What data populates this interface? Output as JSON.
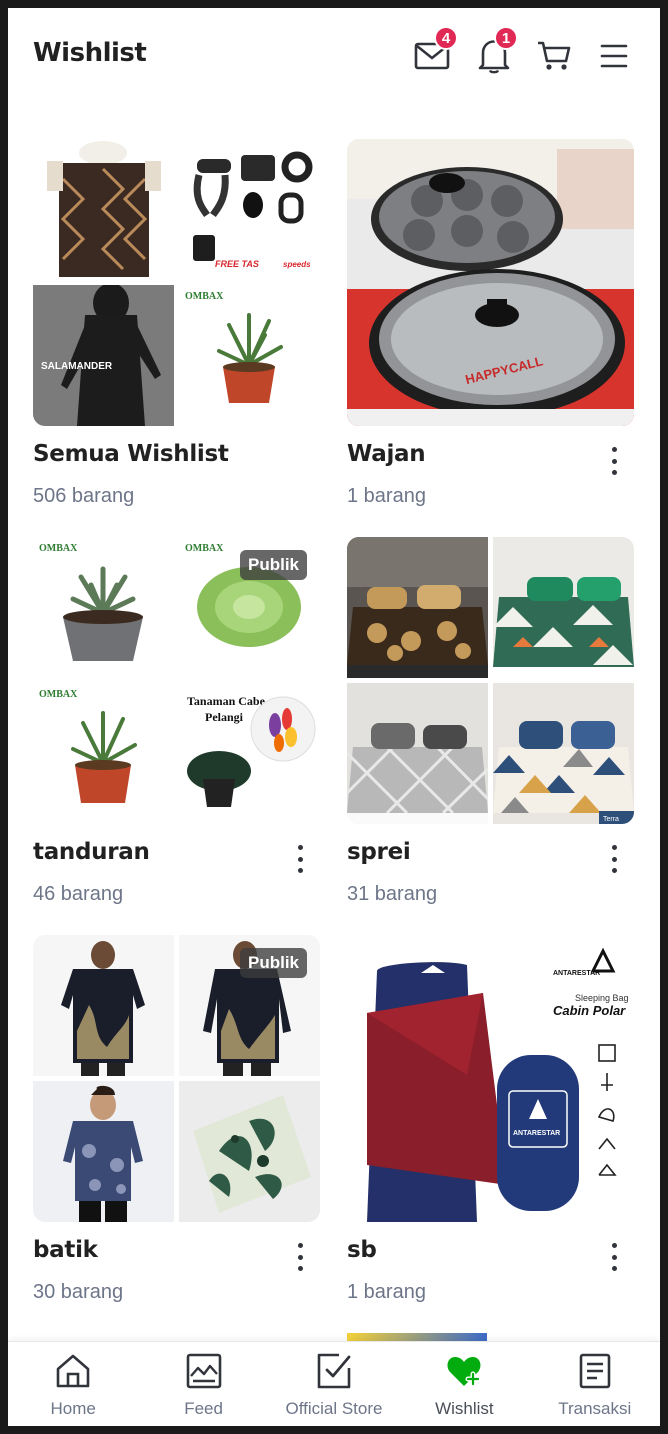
{
  "header": {
    "title": "Wishlist",
    "inbox_badge": "4",
    "notification_badge": "1",
    "icons": [
      "mail-icon",
      "bell-icon",
      "cart-icon",
      "menu-icon"
    ]
  },
  "collections": [
    {
      "name": "Semua Wishlist",
      "count": "506 barang"
    },
    {
      "name": "Wajan",
      "count": "1 barang"
    },
    {
      "name": "tanduran",
      "count": "46 barang",
      "badge": "Publik"
    },
    {
      "name": "sprei",
      "count": "31 barang"
    },
    {
      "name": "batik",
      "count": "30 barang",
      "badge": "Publik"
    },
    {
      "name": "sb",
      "count": "1 barang"
    }
  ],
  "image_text": {
    "free_tas": "FREE TAS",
    "speeds": "speeds",
    "salamander": "SALAMANDER",
    "ombax": "OMBAX",
    "tanaman_cabe": "Tanaman Cabe",
    "pelangi": "Pelangi",
    "terra": "Terra",
    "cabin_polar_brand": "Sleeping Bag",
    "cabin_polar": "Cabin Polar",
    "antarestar": "ANTARESTAR",
    "happycall": "HAPPYCALL"
  },
  "bottom_nav": [
    {
      "label": "Home",
      "icon": "home-icon"
    },
    {
      "label": "Feed",
      "icon": "feed-icon"
    },
    {
      "label": "Official Store",
      "icon": "official-store-icon"
    },
    {
      "label": "Wishlist",
      "icon": "wishlist-heart-icon",
      "active": true
    },
    {
      "label": "Transaksi",
      "icon": "transaction-icon"
    }
  ],
  "colors": {
    "accent_green": "#03ac0e",
    "badge_red": "#e02954",
    "text_primary": "#212121",
    "text_secondary": "#6d7588"
  }
}
